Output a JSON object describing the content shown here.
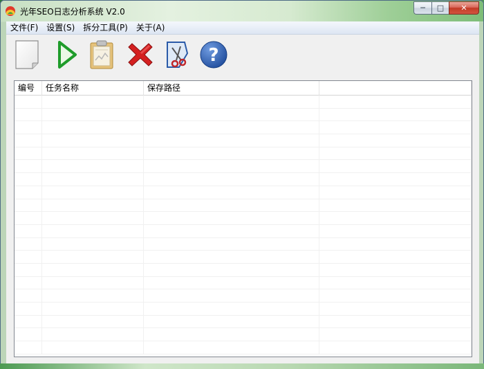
{
  "window": {
    "title": "光年SEO日志分析系统 V2.0",
    "minimize_label": "─",
    "maximize_label": "□",
    "close_label": "✕"
  },
  "menubar": {
    "items": [
      {
        "label": "文件(F)"
      },
      {
        "label": "设置(S)"
      },
      {
        "label": "拆分工具(P)"
      },
      {
        "label": "关于(A)"
      }
    ]
  },
  "toolbar": {
    "tools": [
      {
        "name": "new",
        "icon": "blank-page-icon"
      },
      {
        "name": "start",
        "icon": "play-icon"
      },
      {
        "name": "report",
        "icon": "clipboard-icon"
      },
      {
        "name": "delete",
        "icon": "red-x-icon"
      },
      {
        "name": "split",
        "icon": "scissors-icon"
      },
      {
        "name": "help",
        "icon": "question-icon"
      }
    ]
  },
  "task_list": {
    "columns": [
      "编号",
      "任务名称",
      "保存路径",
      ""
    ],
    "rows": []
  },
  "colors": {
    "accent_green": "#1f9c2b",
    "delete_red": "#d42020",
    "help_blue": "#2a5aa8"
  }
}
